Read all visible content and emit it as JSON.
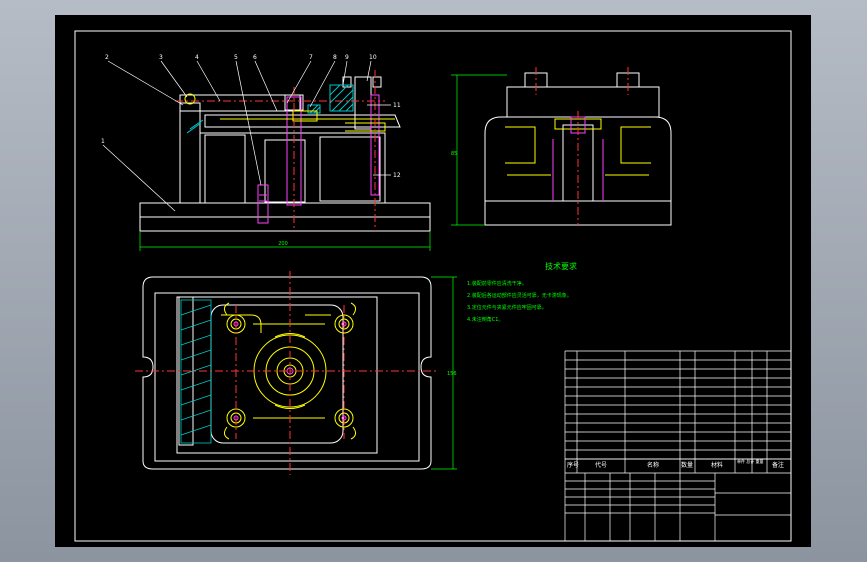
{
  "drawing": {
    "colors": {
      "background": "#000000",
      "frame_line": "#ffffff",
      "outline": "#ffffff",
      "center_line": "#ff3333",
      "hidden_line": "#ffff00",
      "dimension": "#00ff00",
      "hatch": "#00c8c8",
      "bolt": "#ff40ff",
      "accent": "#ffff00"
    },
    "balloons": [
      "2",
      "3",
      "4",
      "5",
      "6",
      "7",
      "8",
      "9",
      "10",
      "11",
      "12",
      "1"
    ],
    "dimensions": {
      "front_width": "200",
      "side_height": "85",
      "plan_height": "156"
    },
    "technical_requirements": {
      "title": "技术要求",
      "lines": [
        "1.装配前零件应清洗干净。",
        "2.装配后各运动部件应灵活可靠，无卡滞现象。",
        "3.定位元件与夹紧元件应牢固可靠。",
        "4.未注倒角C1。"
      ]
    },
    "title_block": {
      "header": {
        "seq": "序号",
        "code": "代号",
        "name": "名称",
        "qty": "数量",
        "material": "材料",
        "weight": "单件 总计 重量",
        "remark": "备注"
      }
    }
  }
}
